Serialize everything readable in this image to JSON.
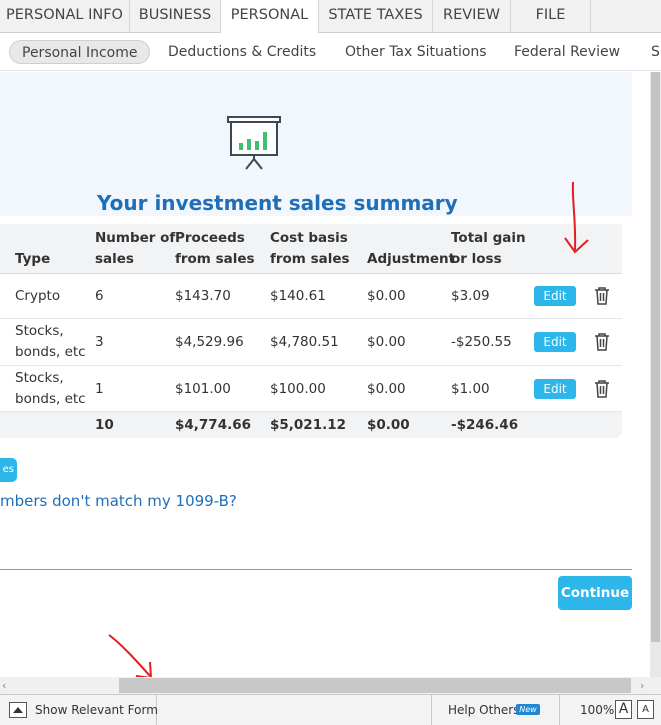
{
  "top_tabs": [
    {
      "label": "PERSONAL INFO",
      "active": false
    },
    {
      "label": "BUSINESS",
      "active": false
    },
    {
      "label": "PERSONAL",
      "active": true
    },
    {
      "label": "STATE TAXES",
      "active": false
    },
    {
      "label": "REVIEW",
      "active": false
    },
    {
      "label": "FILE",
      "active": false
    }
  ],
  "sub_tabs": [
    {
      "label": "Personal Income",
      "active": true
    },
    {
      "label": "Deductions & Credits",
      "active": false
    },
    {
      "label": "Other Tax Situations",
      "active": false
    },
    {
      "label": "Federal Review",
      "active": false
    },
    {
      "label": "Su",
      "active": false
    }
  ],
  "hero": {
    "title": "Your investment sales summary",
    "icon": "presentation-chart-icon"
  },
  "table": {
    "headers": {
      "type": "Type",
      "number_l1": "Number of",
      "number_l2": "sales",
      "proceeds_l1": "Proceeds",
      "proceeds_l2": "from sales",
      "cost_l1": "Cost basis",
      "cost_l2": "from sales",
      "adjustment": "Adjustment",
      "gain_l1": "Total gain",
      "gain_l2": "or loss"
    },
    "rows": [
      {
        "type_l1": "Crypto",
        "type_l2": "",
        "number": "6",
        "proceeds": "$143.70",
        "cost": "$140.61",
        "adjustment": "$0.00",
        "gain": "$3.09",
        "edit": "Edit"
      },
      {
        "type_l1": "Stocks,",
        "type_l2": "bonds, etc",
        "number": "3",
        "proceeds": "$4,529.96",
        "cost": "$4,780.51",
        "adjustment": "$0.00",
        "gain": "-$250.55",
        "edit": "Edit"
      },
      {
        "type_l1": "Stocks,",
        "type_l2": "bonds, etc",
        "number": "1",
        "proceeds": "$101.00",
        "cost": "$100.00",
        "adjustment": "$0.00",
        "gain": "$1.00",
        "edit": "Edit"
      }
    ],
    "totals": {
      "number": "10",
      "proceeds": "$4,774.66",
      "cost": "$5,021.12",
      "adjustment": "$0.00",
      "gain": "-$246.46"
    }
  },
  "partial_button_label": "es",
  "help_link": "mbers don't match my 1099-B?",
  "continue_label": "Continue",
  "bottom_bar": {
    "show_form": "Show Relevant Form",
    "help_others": "Help Others",
    "new_badge": "New",
    "zoom": "100%",
    "font_large": "A",
    "font_small": "A"
  },
  "colors": {
    "accent": "#2db6ea",
    "title_blue": "#1f6fb8",
    "annotation_red": "#e02020"
  }
}
